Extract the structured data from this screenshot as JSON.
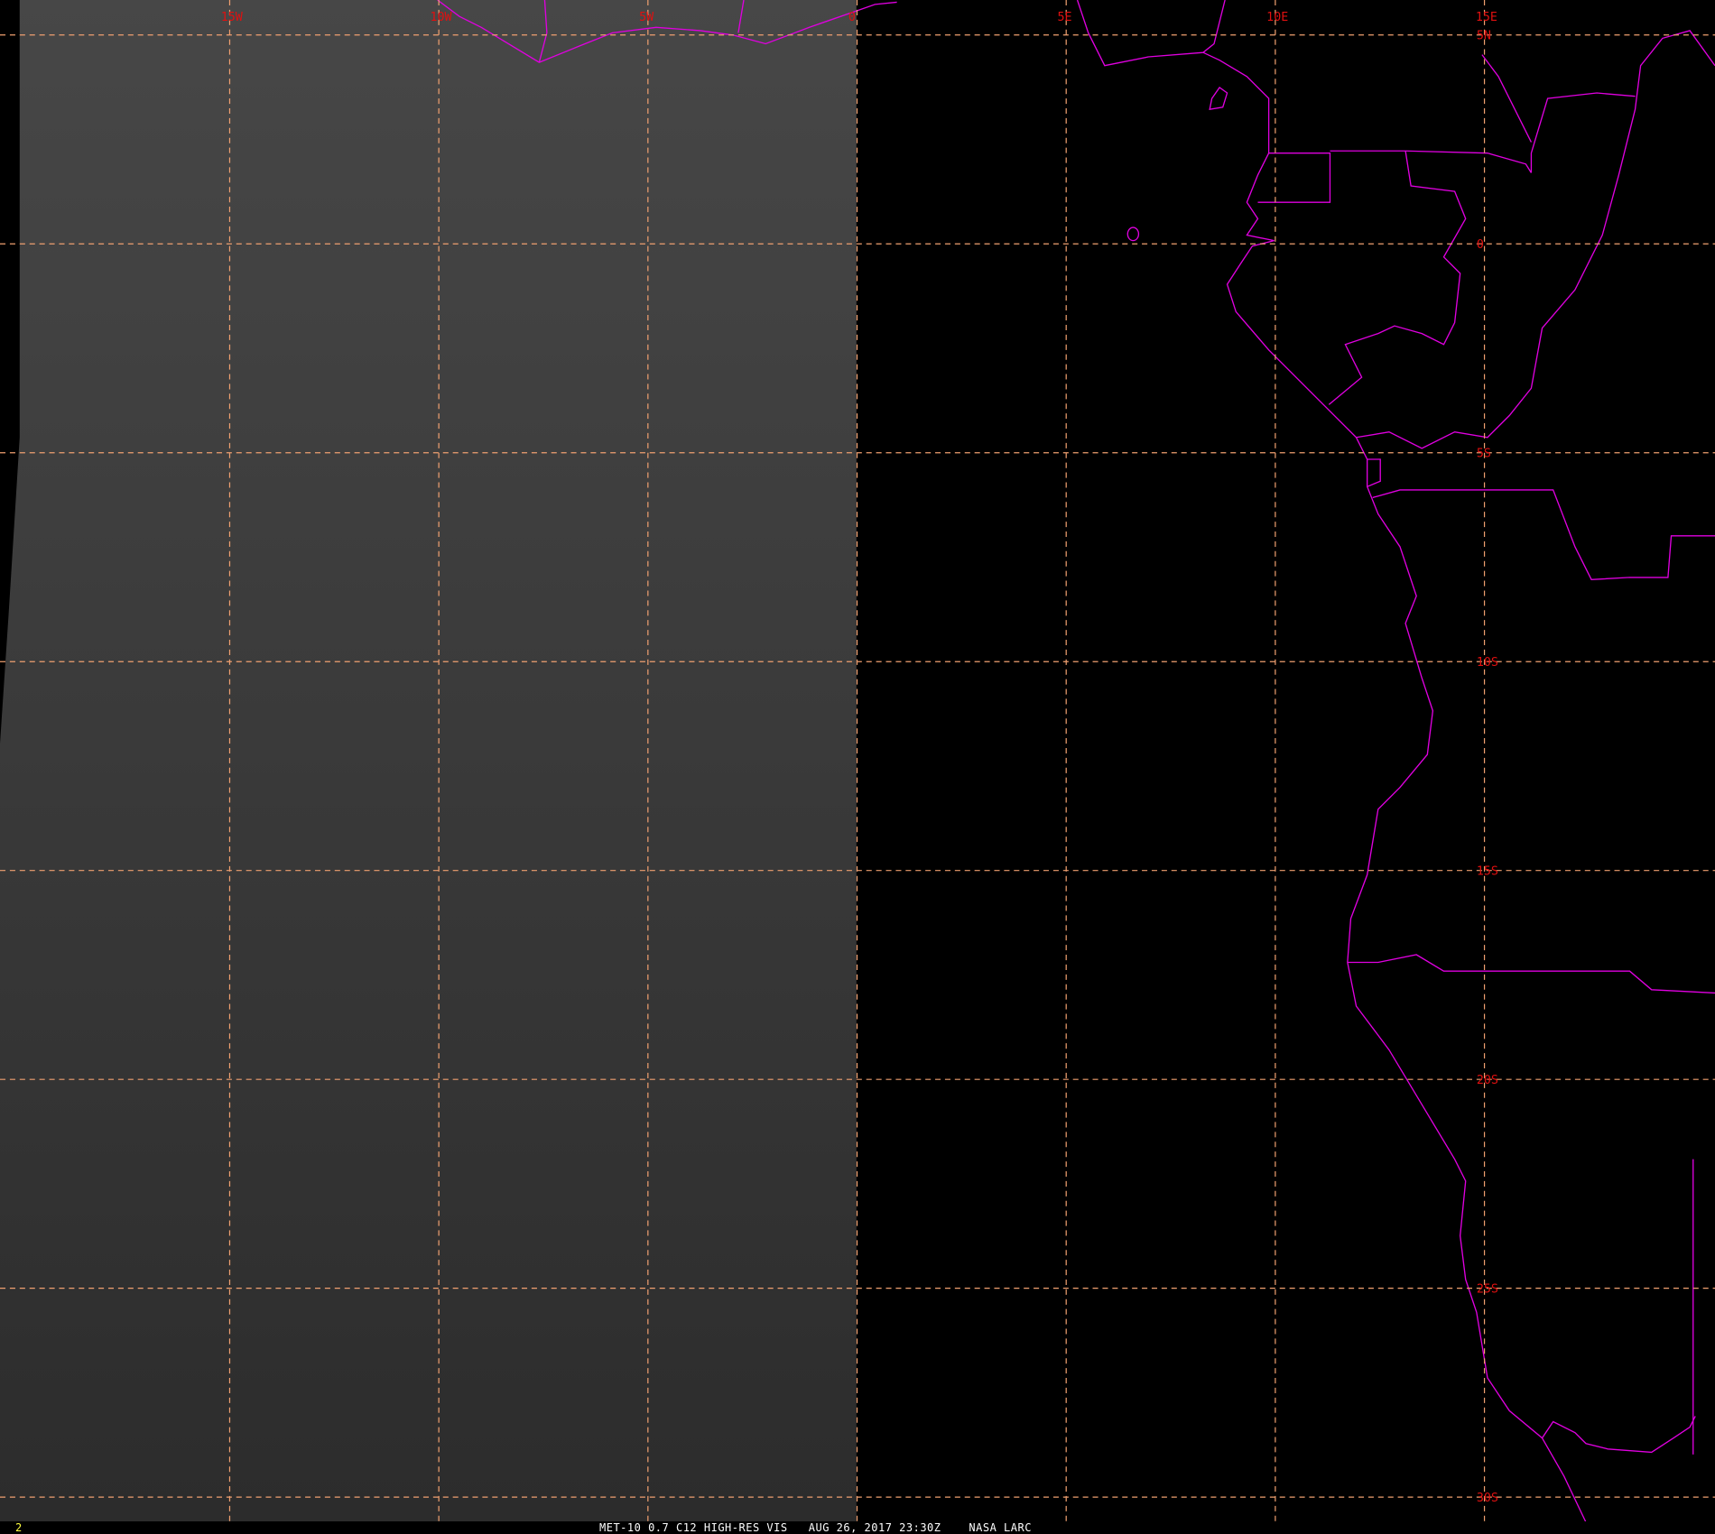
{
  "map": {
    "longitudes": [
      "15W",
      "10W",
      "5W",
      "0",
      "5E",
      "10E",
      "15E"
    ],
    "latitudes": [
      "5N",
      "0",
      "5S",
      "10S",
      "15S",
      "20S",
      "25S",
      "30S"
    ],
    "colors": {
      "grid": "#f0a070",
      "labels": "#e01010",
      "coastline": "#e000e0",
      "image_top": "#474747",
      "image_bottom": "#2c2c2c"
    }
  },
  "footer": {
    "frame_number": "2",
    "caption": "MET-10 0.7 C12 HIGH-RES VIS   AUG 26, 2017 23:30Z    NASA LARC"
  }
}
